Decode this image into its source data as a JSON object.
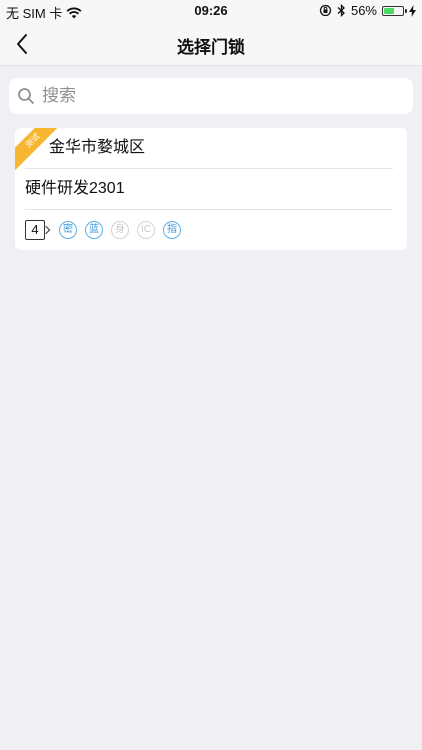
{
  "status_bar": {
    "carrier": "无 SIM 卡",
    "time": "09:26",
    "battery_percent": "56%",
    "battery_level": 0.56,
    "battery_color": "#4cd964"
  },
  "nav": {
    "title": "选择门锁",
    "back_icon": "chevron-left-icon"
  },
  "search": {
    "placeholder": "搜索",
    "value": ""
  },
  "locks": [
    {
      "ribbon_label": "测试",
      "ribbon_color": "#f7b631",
      "city": "金华市婺城区",
      "name": "硬件研发2301",
      "count": "4",
      "features": [
        {
          "label": "密",
          "enabled": true
        },
        {
          "label": "蓝",
          "enabled": true
        },
        {
          "label": "身",
          "enabled": false
        },
        {
          "label": "IC",
          "enabled": false
        },
        {
          "label": "指",
          "enabled": true
        }
      ]
    }
  ],
  "colors": {
    "accent": "#3b97dd",
    "background": "#efeff4"
  }
}
